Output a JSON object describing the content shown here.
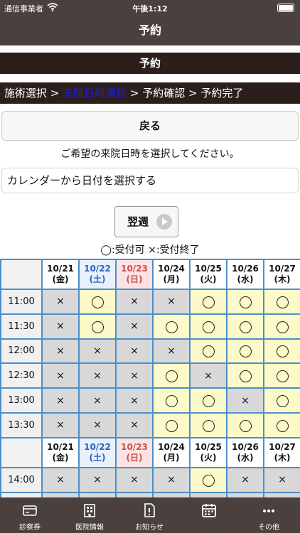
{
  "status_bar": {
    "carrier": "通信事業者",
    "time": "午後1:12"
  },
  "nav": {
    "title": "予約"
  },
  "section_title": "予約",
  "steps": [
    "施術選択",
    "来院日時選択",
    "予約確認",
    "予約完了"
  ],
  "step_separator": " > ",
  "back_button": "戻る",
  "instruction": "ご希望の来院日時を選択してください。",
  "date_picker": "カレンダーから日付を選択する",
  "next_week_button": "翌週",
  "legend": "◯:受付可 ×:受付終了",
  "schedule": {
    "days": [
      {
        "date": "10/21",
        "weekday": "(金)",
        "type": "weekday"
      },
      {
        "date": "10/22",
        "weekday": "(土)",
        "type": "sat"
      },
      {
        "date": "10/23",
        "weekday": "(日)",
        "type": "sun"
      },
      {
        "date": "10/24",
        "weekday": "(月)",
        "type": "weekday"
      },
      {
        "date": "10/25",
        "weekday": "(火)",
        "type": "weekday"
      },
      {
        "date": "10/26",
        "weekday": "(水)",
        "type": "weekday"
      },
      {
        "date": "10/27",
        "weekday": "(木)",
        "type": "weekday"
      }
    ],
    "open_mark": "◯",
    "closed_mark": "×",
    "slots": [
      {
        "time": "11:00",
        "status": [
          "×",
          "◯",
          "×",
          "×",
          "◯",
          "◯",
          "◯"
        ]
      },
      {
        "time": "11:30",
        "status": [
          "×",
          "◯",
          "×",
          "◯",
          "◯",
          "◯",
          "◯"
        ]
      },
      {
        "time": "12:00",
        "status": [
          "×",
          "×",
          "×",
          "×",
          "◯",
          "◯",
          "◯"
        ]
      },
      {
        "time": "12:30",
        "status": [
          "×",
          "×",
          "×",
          "◯",
          "×",
          "◯",
          "◯"
        ]
      },
      {
        "time": "13:00",
        "status": [
          "×",
          "×",
          "×",
          "◯",
          "◯",
          "×",
          "◯"
        ]
      },
      {
        "time": "13:30",
        "status": [
          "×",
          "×",
          "×",
          "◯",
          "◯",
          "◯",
          "◯"
        ]
      },
      {
        "repeat_header": true
      },
      {
        "time": "14:00",
        "status": [
          "×",
          "×",
          "×",
          "×",
          "◯",
          "×",
          "×"
        ]
      },
      {
        "time": "14:30",
        "status": [
          "×",
          "×",
          "×",
          "×",
          "×",
          "×",
          "×"
        ]
      }
    ]
  },
  "tab_bar": [
    {
      "label": "診察券",
      "icon": "card-icon",
      "active": false
    },
    {
      "label": "医院情報",
      "icon": "building-icon",
      "active": false
    },
    {
      "label": "お知らせ",
      "icon": "notice-icon",
      "active": false
    },
    {
      "label": "予約",
      "icon": "calendar-icon",
      "active": true
    },
    {
      "label": "その他",
      "icon": "more-icon",
      "active": false
    }
  ]
}
